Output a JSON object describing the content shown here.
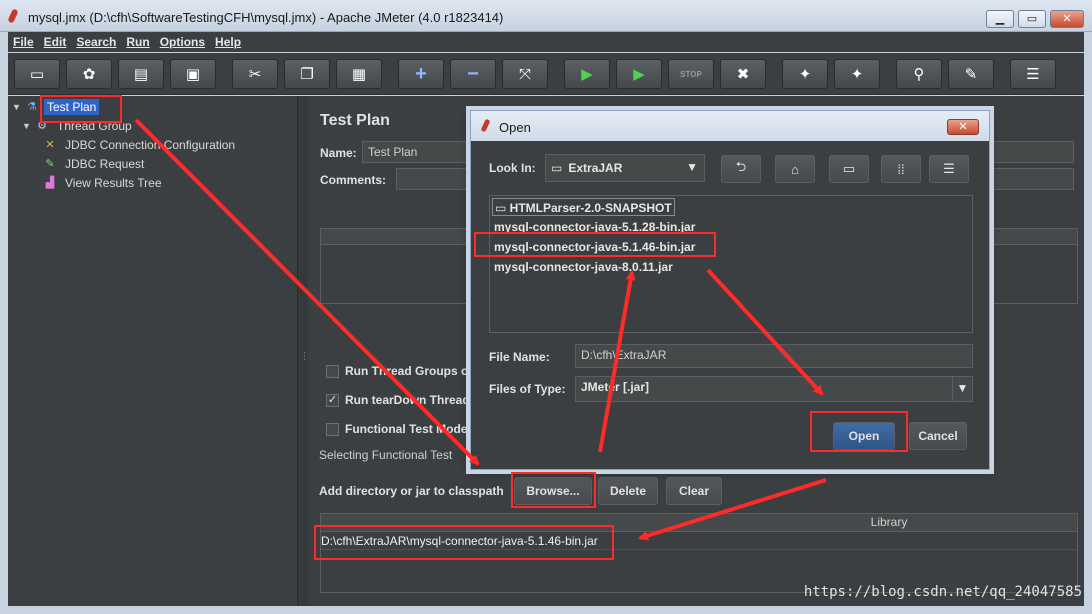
{
  "window": {
    "title": "mysql.jmx (D:\\cfh\\SoftwareTestingCFH\\mysql.jmx) - Apache JMeter (4.0 r1823414)",
    "controls": [
      "▁",
      "▭",
      "✕"
    ]
  },
  "menu": [
    "File",
    "Edit",
    "Search",
    "Run",
    "Options",
    "Help"
  ],
  "toolbar": [
    {
      "name": "new-icon",
      "glyph": "▭"
    },
    {
      "name": "templates-icon",
      "glyph": "✿"
    },
    {
      "name": "open-icon",
      "glyph": "▤"
    },
    {
      "name": "save-icon",
      "glyph": "▣"
    },
    {
      "name": "cut-icon",
      "glyph": "✂"
    },
    {
      "name": "copy-icon",
      "glyph": "❐"
    },
    {
      "name": "paste-icon",
      "glyph": "▦"
    },
    {
      "name": "expand-icon",
      "glyph": "+"
    },
    {
      "name": "collapse-icon",
      "glyph": "−"
    },
    {
      "name": "toggle-icon",
      "glyph": "⤧"
    },
    {
      "name": "start-icon",
      "glyph": "▶"
    },
    {
      "name": "start-no-pauses-icon",
      "glyph": "▶"
    },
    {
      "name": "stop-icon",
      "glyph": "STOP"
    },
    {
      "name": "shutdown-icon",
      "glyph": "✖"
    },
    {
      "name": "clear-icon",
      "glyph": "✦"
    },
    {
      "name": "clear-all-icon",
      "glyph": "✦"
    },
    {
      "name": "search-icon",
      "glyph": "⚲"
    },
    {
      "name": "reset-search-icon",
      "glyph": "✎"
    },
    {
      "name": "function-helper-icon",
      "glyph": "☰"
    }
  ],
  "tree": {
    "items": [
      {
        "label": "Test Plan",
        "icon": "test-plan-icon",
        "glyph": "⚗",
        "color": "#6fa8ff",
        "twist": "▼",
        "selected": true
      },
      {
        "label": "Thread Group",
        "icon": "gear-icon",
        "glyph": "⚙",
        "color": "#a9c7ff",
        "twist": "▼"
      },
      {
        "label": "JDBC Connection Configuration",
        "icon": "wrench-icon",
        "glyph": "✕",
        "color": "#d8b25a",
        "twist": ""
      },
      {
        "label": "JDBC Request",
        "icon": "pen-icon",
        "glyph": "✎",
        "color": "#8fd17a",
        "twist": ""
      },
      {
        "label": "View Results Tree",
        "icon": "chart-icon",
        "glyph": "▟",
        "color": "#e07ad8",
        "twist": ""
      }
    ]
  },
  "main": {
    "heading": "Test Plan",
    "name_label": "Name:",
    "name_value": "Test Plan",
    "comments_label": "Comments:",
    "checkboxes": [
      {
        "label": "Run Thread Groups co",
        "checked": false
      },
      {
        "label": "Run tearDown Thread",
        "checked": true
      },
      {
        "label": "Functional Test Mode",
        "checked": false
      }
    ],
    "functional_note": "Selecting Functional Test",
    "classpath_label": "Add directory or jar to classpath",
    "browse_button": "Browse...",
    "delete_button": "Delete",
    "clear_button": "Clear",
    "library_header": "Library",
    "library_row": "D:\\cfh\\ExtraJAR\\mysql-connector-java-5.1.46-bin.jar"
  },
  "dialog": {
    "title": "Open",
    "close_label": "✕",
    "look_in_label": "Look In:",
    "look_in_value": "ExtraJAR",
    "files": [
      {
        "name": "HTMLParser-2.0-SNAPSHOT",
        "folder": true
      },
      {
        "name": "mysql-connector-java-5.1.28-bin.jar",
        "folder": false
      },
      {
        "name": "mysql-connector-java-5.1.46-bin.jar",
        "folder": false
      },
      {
        "name": "mysql-connector-java-8.0.11.jar",
        "folder": false
      }
    ],
    "file_name_label": "File Name:",
    "file_name_value": "D:\\cfh\\ExtraJAR",
    "file_type_label": "Files of Type:",
    "file_type_value": "JMeter [.jar]",
    "open_button": "Open",
    "cancel_button": "Cancel"
  },
  "watermark": "https://blog.csdn.net/qq_24047585",
  "colors": {
    "annotation": "#ff2a2a",
    "selection": "#2f65ca",
    "panel": "#3c3f41"
  }
}
